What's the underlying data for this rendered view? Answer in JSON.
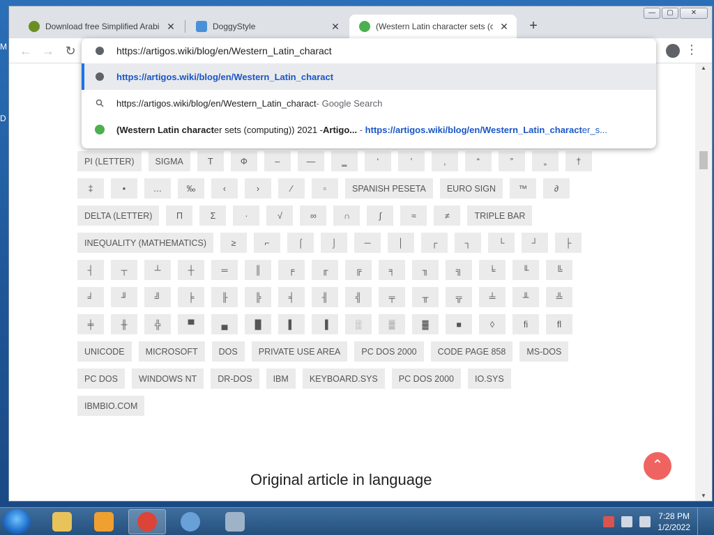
{
  "desktop": {
    "labels": [
      "M",
      "D"
    ]
  },
  "window": {
    "tabs": [
      {
        "title": "Download free Simplified Arabic",
        "favicon_color": "#6b8e23",
        "active": false
      },
      {
        "title": "DoggyStyle",
        "favicon_color": "#4a90d9",
        "active": false
      },
      {
        "title": "(Western Latin character sets (co",
        "favicon_color": "#4caf50",
        "active": true
      }
    ],
    "newtab_glyph": "+",
    "controls": {
      "minimize": "—",
      "maximize": "▢",
      "close": "✕"
    }
  },
  "toolbar": {
    "back": "←",
    "forward": "→",
    "reload": "↻",
    "menu": "⋮"
  },
  "omnibox": {
    "input_text": "https://artigos.wiki/blog/en/Western_Latin_charact",
    "suggestions": [
      {
        "icon": "globe-icon",
        "text": "https://artigos.wiki/blog/en/Western_Latin_charact",
        "suffix": ""
      },
      {
        "icon": "search-icon",
        "text": "https://artigos.wiki/blog/en/Western_Latin_charact",
        "suffix": " - Google Search"
      },
      {
        "icon": "site-favicon",
        "title_bold": "(Western Latin charact",
        "title_rest": "er sets (computing)) 2021 - ",
        "title_bold2": "Artigo...",
        "sep": " - ",
        "url_bold": "https://artigos.wiki/blog/en/Western_Latin_charact",
        "url_rest": "er_s..."
      }
    ]
  },
  "page": {
    "chip_rows": [
      [
        "PI (LETTER)",
        "SIGMA",
        "Τ",
        "Φ",
        "–",
        "—",
        "‗",
        "‘",
        "’",
        "‚",
        "“",
        "”",
        "„",
        "†"
      ],
      [
        "‡",
        "•",
        "…",
        "‰",
        "‹",
        "›",
        "⁄",
        "▫",
        "SPANISH PESETA",
        "EURO SIGN",
        "™",
        "∂"
      ],
      [
        "DELTA (LETTER)",
        "Π",
        "Σ",
        "·",
        "√",
        "∞",
        "∩",
        "∫",
        "≈",
        "≠",
        "TRIPLE BAR"
      ],
      [
        "INEQUALITY (MATHEMATICS)",
        "≥",
        "⌐",
        "⌠",
        "⌡",
        "─",
        "│",
        "┌",
        "┐",
        "└",
        "┘",
        "├"
      ],
      [
        "┤",
        "┬",
        "┴",
        "┼",
        "═",
        "║",
        "╒",
        "╓",
        "╔",
        "╕",
        "╖",
        "╗",
        "╘",
        "╙",
        "╚"
      ],
      [
        "╛",
        "╜",
        "╝",
        "╞",
        "╟",
        "╠",
        "╡",
        "╢",
        "╣",
        "╤",
        "╥",
        "╦",
        "╧",
        "╨",
        "╩"
      ],
      [
        "╪",
        "╫",
        "╬",
        "▀",
        "▄",
        "█",
        "▌",
        "▐",
        "░",
        "▒",
        "▓",
        "■",
        "◊",
        "ﬁ",
        "ﬂ"
      ],
      [
        "UNICODE",
        "MICROSOFT",
        "DOS",
        "PRIVATE USE AREA",
        "PC DOS 2000",
        "CODE PAGE 858",
        "MS-DOS"
      ],
      [
        "PC DOS",
        "WINDOWS NT",
        "DR-DOS",
        "IBM",
        "KEYBOARD.SYS",
        "PC DOS 2000",
        "IO.SYS"
      ],
      [
        "IBMBIO.COM"
      ]
    ],
    "section_heading": "Original article in language",
    "back_to_top": "⌃"
  },
  "taskbar": {
    "items": [
      {
        "name": "explorer",
        "color": "#e8c35a"
      },
      {
        "name": "media-player",
        "color": "#f0a030"
      },
      {
        "name": "chrome",
        "color": "#db4437",
        "active": true
      },
      {
        "name": "eyes-app",
        "color": "#6aa0d8"
      },
      {
        "name": "lambda-app",
        "color": "#9fb3c8"
      }
    ],
    "clock_time": "7:28 PM",
    "clock_date": "1/2/2022"
  }
}
